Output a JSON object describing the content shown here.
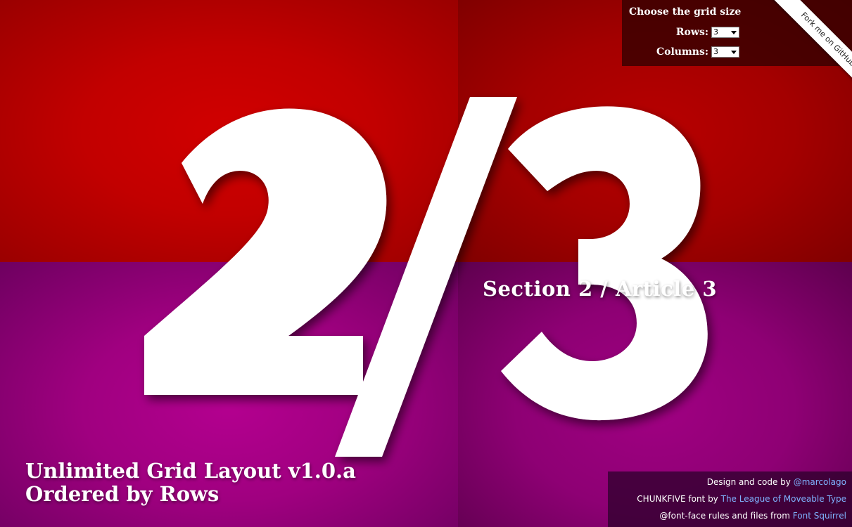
{
  "grid": {
    "rows": 2,
    "columns": 2
  },
  "article": {
    "section": "2",
    "article": "3",
    "big_label": "2/3",
    "title": "Section 2 / Article 3"
  },
  "headline": {
    "line1": "Unlimited Grid Layout v1.0.a",
    "line2": "Ordered by Rows"
  },
  "controls": {
    "title": "Choose the grid size",
    "rows_label": "Rows:",
    "rows_value": "3",
    "columns_label": "Columns:",
    "columns_value": "3"
  },
  "ribbon": {
    "label": "Fork me on GitHub"
  },
  "credits": {
    "line1_text": "Design and code by ",
    "line1_link": "@marcolago",
    "line2_text": "CHUNKFIVE font by ",
    "line2_link": "The League of Moveable Type",
    "line3_text": "@font-face rules and files from ",
    "line3_link": "Font Squirrel"
  },
  "colors": {
    "red_bright": "#c20000",
    "red_dark": "#a40000",
    "purple_bright": "#a00080",
    "purple_dark": "#8e0074",
    "link": "#7fb2ff"
  }
}
